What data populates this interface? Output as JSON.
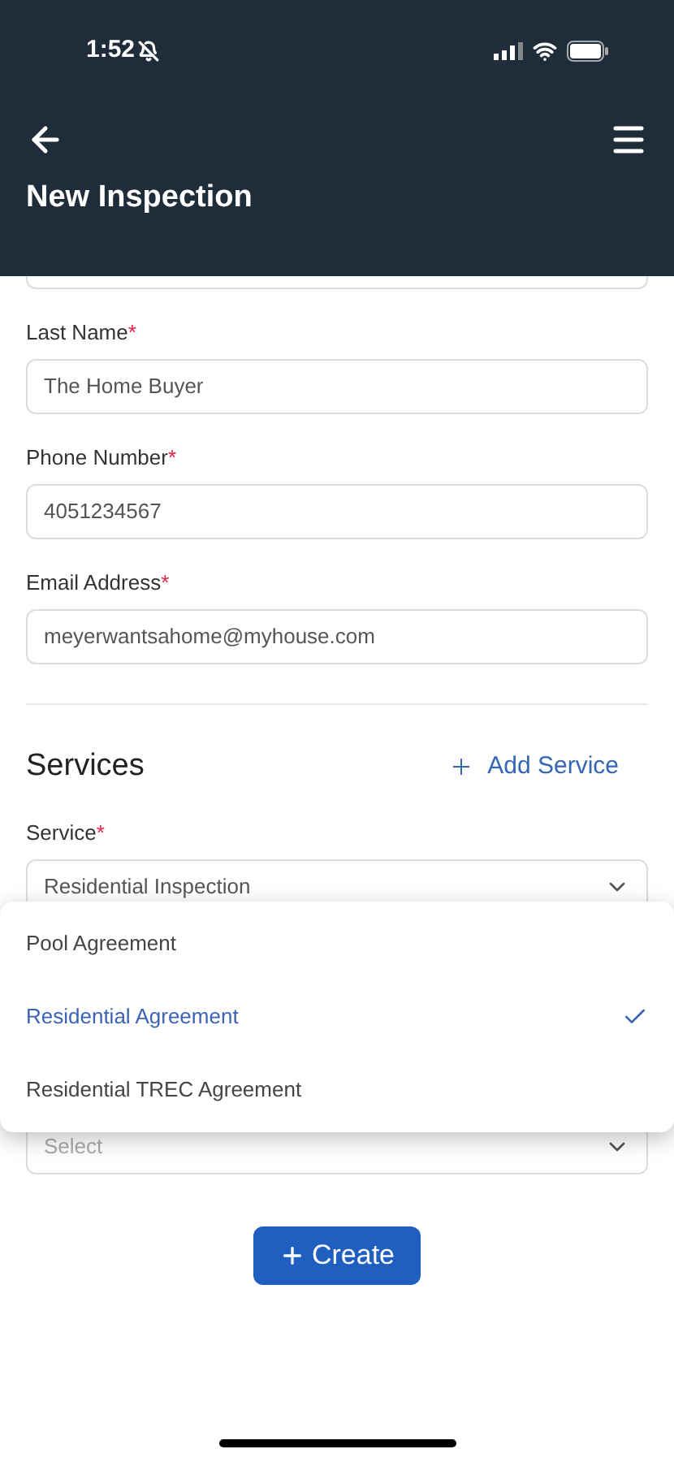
{
  "status_bar": {
    "time": "1:52"
  },
  "header": {
    "title": "New Inspection"
  },
  "contact_fields": [
    {
      "label": "Last Name",
      "mark": "*",
      "value": "The Home Buyer"
    },
    {
      "label": "Phone Number",
      "mark": "*",
      "value": "4051234567"
    },
    {
      "label": "Email Address",
      "mark": "*",
      "value": "meyerwantsahome@myhouse.com"
    }
  ],
  "services": {
    "title": "Services",
    "add_button": "Add Service",
    "service_field": {
      "label": "Service",
      "mark": "*",
      "value": "Residential Inspection"
    },
    "second_field": {
      "placeholder": "Select"
    }
  },
  "dropdown": {
    "options": [
      {
        "label": "Pool Agreement",
        "selected": false
      },
      {
        "label": "Residential Agreement",
        "selected": true
      },
      {
        "label": "Residential TREC Agreement",
        "selected": false
      }
    ]
  },
  "create_button": "Create"
}
